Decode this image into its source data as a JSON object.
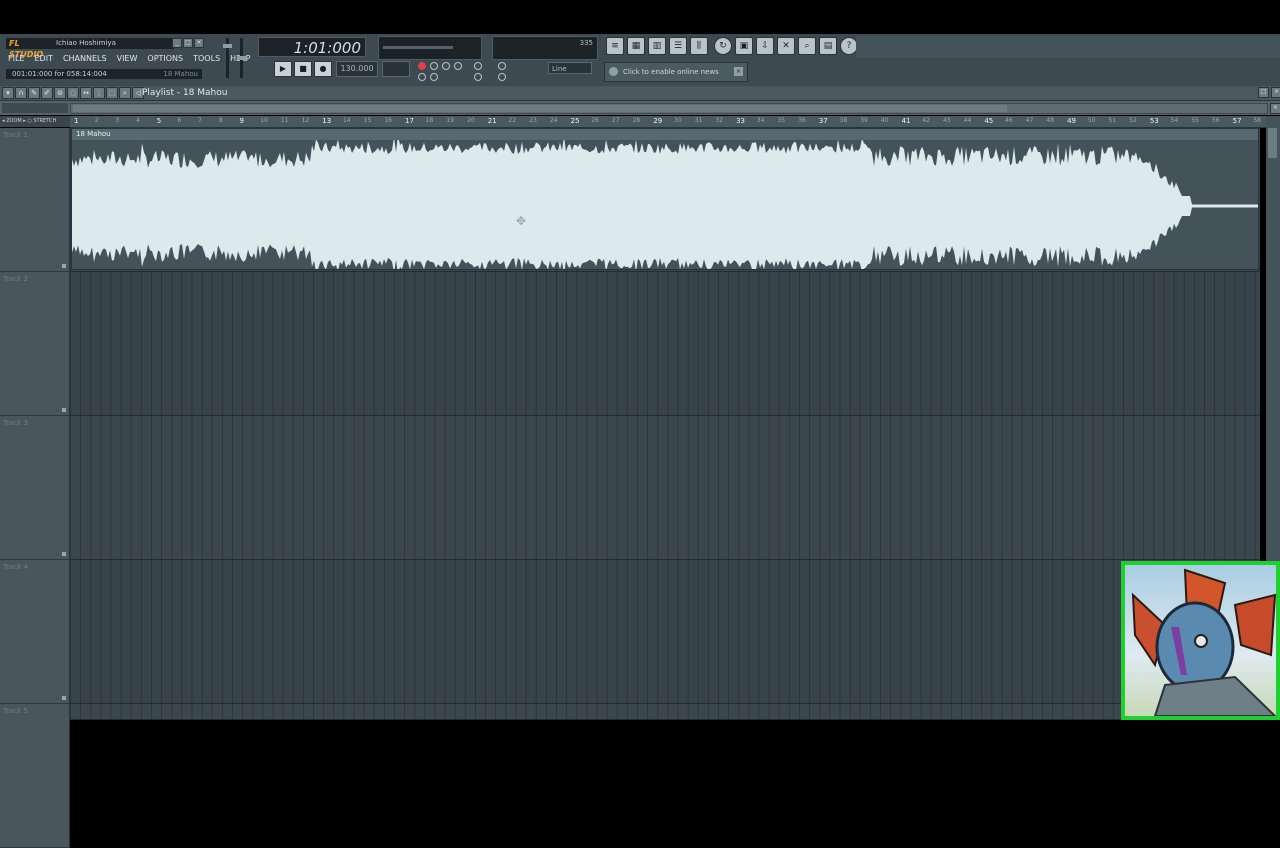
{
  "app": {
    "logo_text": "FL STUDIO",
    "song_name": "Ichiao Hoshimiya",
    "menus": [
      "FILE",
      "EDIT",
      "CHANNELS",
      "VIEW",
      "OPTIONS",
      "TOOLS",
      "HELP"
    ],
    "hint_left": "001:01:000 for 058:14:004",
    "hint_right": "18 Mahou",
    "time_display": "1:01:000",
    "tempo_display": "130.000",
    "cpu_value": "335",
    "snap_label": "Line",
    "online_news": "Click to enable online news"
  },
  "playlist": {
    "title": "Playlist - 18 Mahou",
    "clip_name": "18 Mahou",
    "ruler_labels": [
      "1",
      "2",
      "3",
      "4",
      "5",
      "6",
      "7",
      "8",
      "9",
      "10",
      "11",
      "12",
      "13",
      "14",
      "15",
      "16",
      "17",
      "18",
      "19",
      "20",
      "21",
      "22",
      "23",
      "24",
      "25",
      "26",
      "27",
      "28",
      "29",
      "30",
      "31",
      "32",
      "33",
      "34",
      "35",
      "36",
      "37",
      "38",
      "39",
      "40",
      "41",
      "42",
      "43",
      "44",
      "45",
      "46",
      "47",
      "48",
      "49",
      "50",
      "51",
      "52",
      "53",
      "54",
      "55",
      "56",
      "57",
      "58"
    ],
    "tracks": [
      {
        "label": "Track 1"
      },
      {
        "label": "Track 2"
      },
      {
        "label": "Track 3"
      },
      {
        "label": "Track 4"
      },
      {
        "label": "Track 5"
      }
    ]
  },
  "colors": {
    "waveform": "#dceaec",
    "avatar_border": "#1fd12e",
    "logo": "#f2a32b"
  },
  "icons": [
    "play-icon",
    "stop-icon",
    "record-icon",
    "playlist-icon",
    "piano-roll-icon",
    "mixer-icon",
    "browser-icon",
    "help-icon",
    "pointer-icon",
    "pencil-icon",
    "cut-icon",
    "zoom-icon"
  ]
}
